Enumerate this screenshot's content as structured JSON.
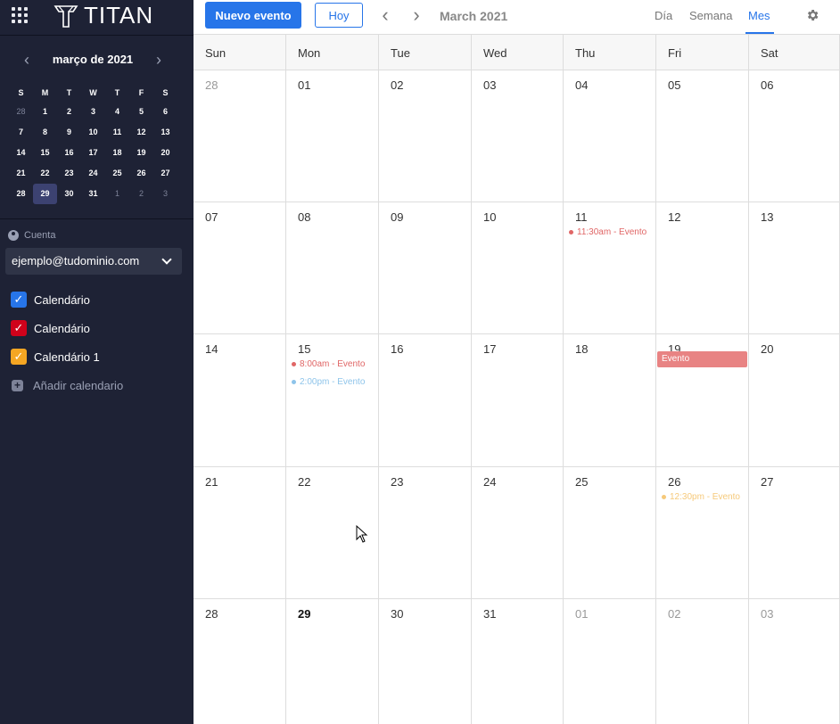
{
  "brand": {
    "name": "TITAN"
  },
  "mini_calendar": {
    "title": "março de 2021",
    "weekdays": [
      "S",
      "M",
      "T",
      "W",
      "T",
      "F",
      "S"
    ],
    "weeks": [
      [
        {
          "d": "28",
          "o": true
        },
        {
          "d": "1"
        },
        {
          "d": "2"
        },
        {
          "d": "3"
        },
        {
          "d": "4"
        },
        {
          "d": "5"
        },
        {
          "d": "6"
        }
      ],
      [
        {
          "d": "7"
        },
        {
          "d": "8"
        },
        {
          "d": "9"
        },
        {
          "d": "10"
        },
        {
          "d": "11"
        },
        {
          "d": "12"
        },
        {
          "d": "13"
        }
      ],
      [
        {
          "d": "14"
        },
        {
          "d": "15"
        },
        {
          "d": "16"
        },
        {
          "d": "17"
        },
        {
          "d": "18"
        },
        {
          "d": "19"
        },
        {
          "d": "20"
        }
      ],
      [
        {
          "d": "21"
        },
        {
          "d": "22"
        },
        {
          "d": "23"
        },
        {
          "d": "24"
        },
        {
          "d": "25"
        },
        {
          "d": "26"
        },
        {
          "d": "27"
        }
      ],
      [
        {
          "d": "28"
        },
        {
          "d": "29",
          "s": true
        },
        {
          "d": "30"
        },
        {
          "d": "31"
        },
        {
          "d": "1",
          "o": true
        },
        {
          "d": "2",
          "o": true
        },
        {
          "d": "3",
          "o": true
        }
      ]
    ]
  },
  "account": {
    "label": "Cuenta",
    "email": "ejemplo@tudominio.com"
  },
  "calendars": [
    {
      "label": "Calendário",
      "color": "#2775e9"
    },
    {
      "label": "Calendário",
      "color": "#d0021b"
    },
    {
      "label": "Calendário 1",
      "color": "#f5a623"
    }
  ],
  "add_calendar_label": "Añadir calendario",
  "toolbar": {
    "new_event_label": "Nuevo evento",
    "today_label": "Hoy",
    "month_title": "March 2021",
    "views": [
      {
        "label": "Día",
        "active": false
      },
      {
        "label": "Semana",
        "active": false
      },
      {
        "label": "Mes",
        "active": true
      }
    ]
  },
  "month": {
    "weekday_headers": [
      "Sun",
      "Mon",
      "Tue",
      "Wed",
      "Thu",
      "Fri",
      "Sat"
    ],
    "weeks": [
      [
        {
          "d": "28",
          "o": true
        },
        {
          "d": "01"
        },
        {
          "d": "02"
        },
        {
          "d": "03"
        },
        {
          "d": "04"
        },
        {
          "d": "05"
        },
        {
          "d": "06"
        }
      ],
      [
        {
          "d": "07"
        },
        {
          "d": "08"
        },
        {
          "d": "09"
        },
        {
          "d": "10"
        },
        {
          "d": "11",
          "events": [
            {
              "text": "11:30am - Evento",
              "color": "#e06666"
            }
          ]
        },
        {
          "d": "12"
        },
        {
          "d": "13"
        }
      ],
      [
        {
          "d": "14"
        },
        {
          "d": "15",
          "events": [
            {
              "text": "8:00am - Evento",
              "color": "#e06666"
            },
            {
              "text": "2:00pm - Evento",
              "color": "#8ec4ea"
            }
          ]
        },
        {
          "d": "16"
        },
        {
          "d": "17"
        },
        {
          "d": "18"
        },
        {
          "d": "19",
          "block": {
            "text": "Evento",
            "color": "#e88383"
          }
        },
        {
          "d": "20"
        }
      ],
      [
        {
          "d": "21"
        },
        {
          "d": "22"
        },
        {
          "d": "23"
        },
        {
          "d": "24"
        },
        {
          "d": "25"
        },
        {
          "d": "26",
          "events": [
            {
              "text": "12:30pm - Evento",
              "color": "#f6c97a"
            }
          ]
        },
        {
          "d": "27"
        }
      ],
      [
        {
          "d": "28"
        },
        {
          "d": "29",
          "t": true
        },
        {
          "d": "30"
        },
        {
          "d": "31"
        },
        {
          "d": "01",
          "o": true
        },
        {
          "d": "02",
          "o": true
        },
        {
          "d": "03",
          "o": true
        }
      ]
    ]
  }
}
